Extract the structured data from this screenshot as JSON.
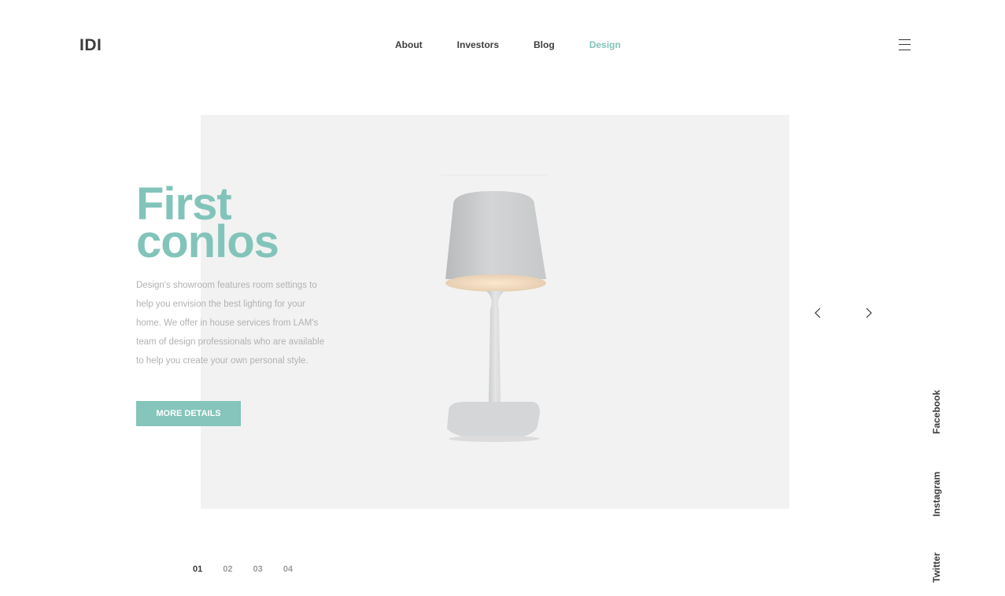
{
  "header": {
    "logo": "IDI",
    "nav": [
      {
        "label": "About"
      },
      {
        "label": "Investors"
      },
      {
        "label": "Blog"
      },
      {
        "label": "Design"
      }
    ],
    "active_nav": "Design"
  },
  "hero": {
    "title_line1": "First",
    "title_line2": "conlos",
    "description": "Design's showroom features room settings to help you envision the best lighting for your home. We offer in house services from LAM's team of design professionals who are available to help you create your own personal style.",
    "button_label": "MORE DETAILS"
  },
  "slider": {
    "pages": [
      "01",
      "02",
      "03",
      "04"
    ],
    "active_page": "01",
    "prev_icon": "chevron-left-icon",
    "next_icon": "chevron-right-icon"
  },
  "social": [
    {
      "label": "Facebook"
    },
    {
      "label": "Instagram"
    },
    {
      "label": "Twitter"
    }
  ],
  "colors": {
    "accent": "#82c4ba",
    "hero_background": "#f2f2f2",
    "text_dark": "#3c3c3c",
    "text_muted": "#b2b2b2"
  }
}
